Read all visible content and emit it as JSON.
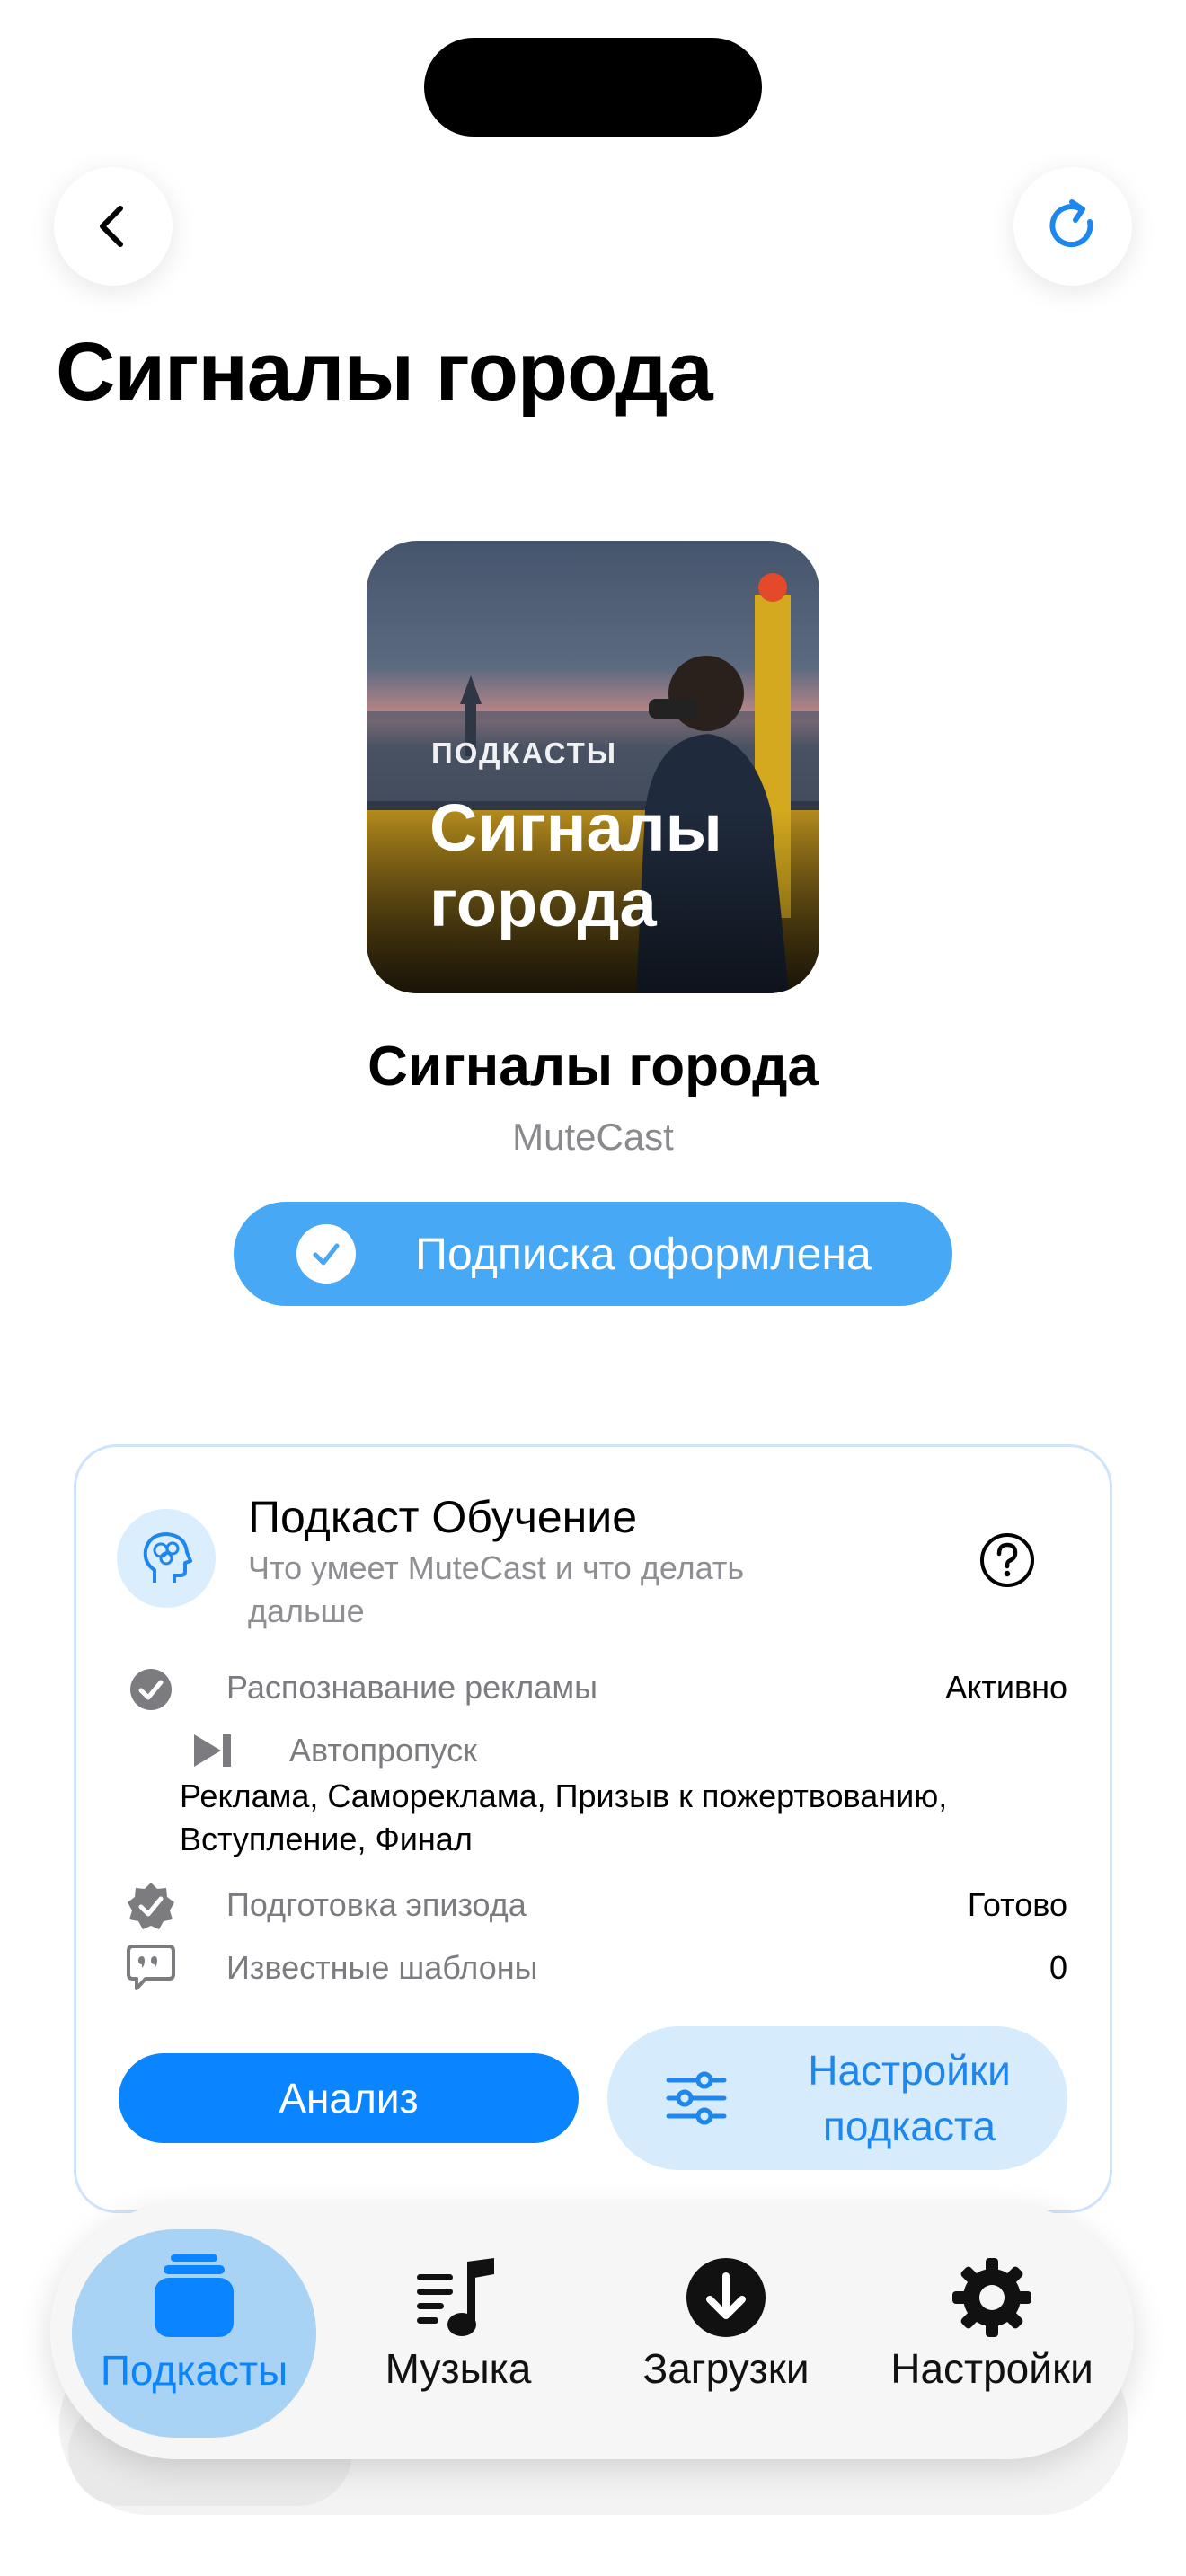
{
  "header": {
    "back_icon": "chevron-left-icon",
    "refresh_icon": "refresh-icon",
    "title": "Сигналы города"
  },
  "cover": {
    "eyebrow": "ПОДКАСТЫ",
    "title": "Сигналы города"
  },
  "podcast": {
    "name": "Сигналы города",
    "author": "MuteCast",
    "subscribe_label": "Подписка оформлена"
  },
  "learning_card": {
    "title": "Подкаст Обучение",
    "subtitle": "Что умеет MuteCast и что делать дальше",
    "rows": [
      {
        "icon": "checkmark-circle-icon",
        "label": "Распознавание рекламы",
        "value": "Активно"
      },
      {
        "icon": "skip-forward-icon",
        "label": "Автопропуск",
        "detail": "Реклама, Самореклама, Призыв к пожертвованию, Вступление, Финал"
      },
      {
        "icon": "checkmark-seal-icon",
        "label": "Подготовка эпизода",
        "value": "Готово"
      },
      {
        "icon": "quote-bubble-icon",
        "label": "Известные шаблоны",
        "value": "0"
      }
    ],
    "analyze_label": "Анализ",
    "settings_label": "Настройки подкаста"
  },
  "tabbar": {
    "tabs": [
      {
        "label": "Подкасты",
        "icon": "podcasts-stack-icon",
        "active": true
      },
      {
        "label": "Музыка",
        "icon": "music-list-icon",
        "active": false
      },
      {
        "label": "Загрузки",
        "icon": "download-circle-icon",
        "active": false
      },
      {
        "label": "Настройки",
        "icon": "gear-icon",
        "active": false
      }
    ]
  },
  "colors": {
    "accent": "#0a84ff",
    "subscribe_bg": "#47a8f5",
    "settings_bg": "#d6ebfc"
  }
}
